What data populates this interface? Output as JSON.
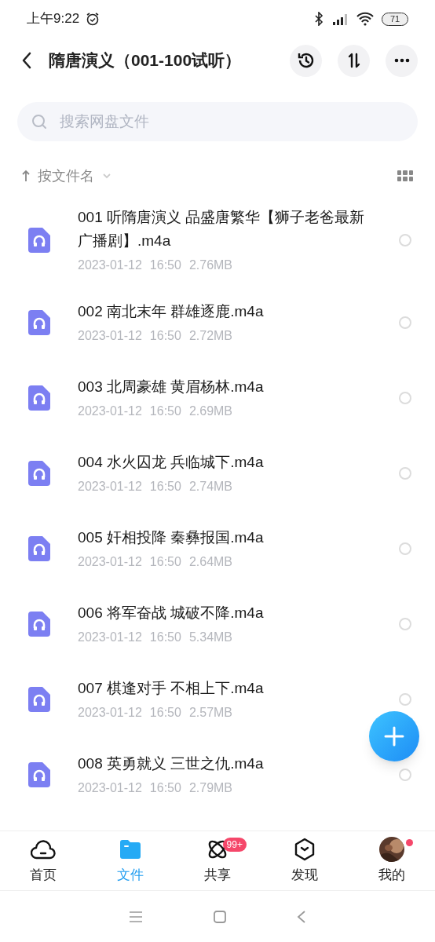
{
  "status_bar": {
    "time": "上午9:22",
    "battery": "71"
  },
  "header": {
    "title": "隋唐演义（001-100试听）"
  },
  "search": {
    "placeholder": "搜索网盘文件"
  },
  "sort": {
    "label": "按文件名"
  },
  "files": [
    {
      "name": "001 听隋唐演义 品盛唐繁华【狮子老爸最新广播剧】.m4a",
      "date": "2023-01-12",
      "time": "16:50",
      "size": "2.76MB",
      "selected": false
    },
    {
      "name": "002 南北末年 群雄逐鹿.m4a",
      "date": "2023-01-12",
      "time": "16:50",
      "size": "2.72MB",
      "selected": false
    },
    {
      "name": "003 北周豪雄 黄眉杨林.m4a",
      "date": "2023-01-12",
      "time": "16:50",
      "size": "2.69MB",
      "selected": false
    },
    {
      "name": "004 水火囚龙 兵临城下.m4a",
      "date": "2023-01-12",
      "time": "16:50",
      "size": "2.74MB",
      "selected": false
    },
    {
      "name": "005 奸相投降 秦彝报国.m4a",
      "date": "2023-01-12",
      "time": "16:50",
      "size": "2.64MB",
      "selected": false
    },
    {
      "name": "006 将军奋战 城破不降.m4a",
      "date": "2023-01-12",
      "time": "16:50",
      "size": "5.34MB",
      "selected": false
    },
    {
      "name": "007 棋逢对手 不相上下.m4a",
      "date": "2023-01-12",
      "time": "16:50",
      "size": "2.57MB",
      "selected": false
    },
    {
      "name": "008 英勇就义 三世之仇.m4a",
      "date": "2023-01-12",
      "time": "16:50",
      "size": "2.79MB",
      "selected": false
    }
  ],
  "tabs": [
    {
      "kind": "home",
      "label": "首页",
      "selected": false
    },
    {
      "kind": "files",
      "label": "文件",
      "selected": true
    },
    {
      "kind": "share",
      "label": "共享",
      "selected": false,
      "badge": "99+"
    },
    {
      "kind": "discover",
      "label": "发现",
      "selected": false
    },
    {
      "kind": "me",
      "label": "我的",
      "selected": false,
      "dot": true
    }
  ]
}
